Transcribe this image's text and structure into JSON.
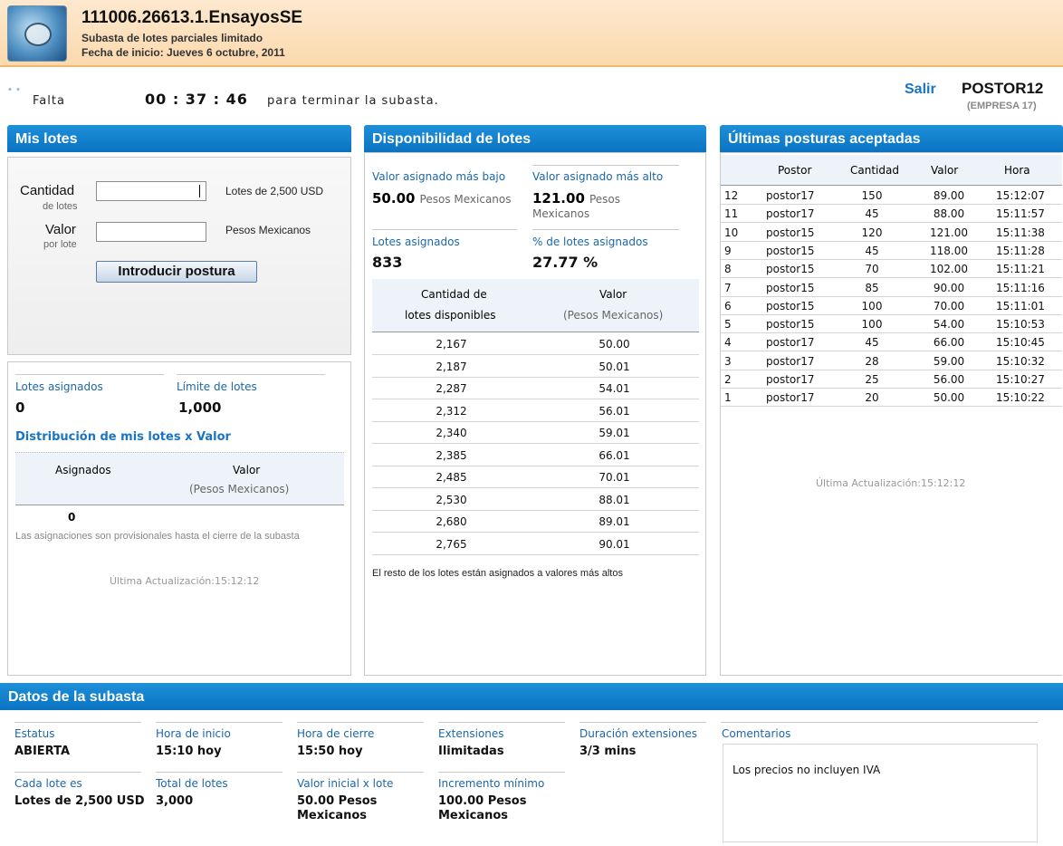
{
  "header": {
    "auction_code": "111006.26613.1.EnsayosSE",
    "auction_type": "Subasta de lotes parciales limitado",
    "start_date": "Fecha de inicio: Jueves 6 octubre, 2011"
  },
  "timer": {
    "prefix": "Falta",
    "value": "00 : 37 : 46",
    "suffix": "para terminar la subasta."
  },
  "user": {
    "logout_label": "Salir",
    "bidder": "POSTOR12",
    "company": "(EMPRESA 17)"
  },
  "mis_lotes": {
    "title": "Mis lotes",
    "quantity_label": "Cantidad",
    "quantity_sub": "de lotes",
    "quantity_value": "",
    "quantity_unit": "Lotes de 2,500 USD",
    "value_label": "Valor",
    "value_sub": "por lote",
    "value_value": "",
    "value_unit": "Pesos Mexicanos",
    "submit_label": "Introducir postura",
    "assigned_label": "Lotes asignados",
    "assigned_value": "0",
    "limit_label": "Límite de lotes",
    "limit_value": "1,000",
    "distribution_title": "Distribución de mis lotes x Valor",
    "col_assigned": "Asignados",
    "col_value": "Valor",
    "col_value_sub": "(Pesos Mexicanos)",
    "row_assigned": "0",
    "note": "Las asignaciones son provisionales hasta el cierre de la subasta",
    "updated": "Última Actualización:15:12:12"
  },
  "disponibilidad": {
    "title": "Disponibilidad de lotes",
    "lowest_label": "Valor asignado más bajo",
    "lowest_value": "50.00",
    "lowest_unit": "Pesos Mexicanos",
    "highest_label": "Valor asignado más alto",
    "highest_value": "121.00",
    "highest_unit_1": "Pesos",
    "highest_unit_2": "Mexicanos",
    "assigned_label": "Lotes asignados",
    "assigned_value": "833",
    "pct_label": "% de lotes asignados",
    "pct_value": "27.77 %",
    "col_qty_1": "Cantidad de",
    "col_qty_2": "lotes disponibles",
    "col_val_1": "Valor",
    "col_val_2": "(Pesos Mexicanos)",
    "rows": [
      {
        "qty": "2,167",
        "val": "50.00"
      },
      {
        "qty": "2,187",
        "val": "50.01"
      },
      {
        "qty": "2,287",
        "val": "54.01"
      },
      {
        "qty": "2,312",
        "val": "56.01"
      },
      {
        "qty": "2,340",
        "val": "59.01"
      },
      {
        "qty": "2,385",
        "val": "66.01"
      },
      {
        "qty": "2,485",
        "val": "70.01"
      },
      {
        "qty": "2,530",
        "val": "88.01"
      },
      {
        "qty": "2,680",
        "val": "89.01"
      },
      {
        "qty": "2,765",
        "val": "90.01"
      }
    ],
    "footer": "El resto de los lotes están asignados a valores más altos"
  },
  "posturas": {
    "title": "Últimas posturas aceptadas",
    "columns": [
      "Postor",
      "Cantidad",
      "Valor",
      "Hora"
    ],
    "rows": [
      {
        "n": "12",
        "postor": "postor17",
        "qty": "150",
        "val": "89.00",
        "hora": "15:12:07"
      },
      {
        "n": "11",
        "postor": "postor17",
        "qty": "45",
        "val": "88.00",
        "hora": "15:11:57"
      },
      {
        "n": "10",
        "postor": "postor15",
        "qty": "120",
        "val": "121.00",
        "hora": "15:11:38"
      },
      {
        "n": "9",
        "postor": "postor15",
        "qty": "45",
        "val": "118.00",
        "hora": "15:11:28"
      },
      {
        "n": "8",
        "postor": "postor15",
        "qty": "70",
        "val": "102.00",
        "hora": "15:11:21"
      },
      {
        "n": "7",
        "postor": "postor15",
        "qty": "85",
        "val": "90.00",
        "hora": "15:11:16"
      },
      {
        "n": "6",
        "postor": "postor15",
        "qty": "100",
        "val": "70.00",
        "hora": "15:11:01"
      },
      {
        "n": "5",
        "postor": "postor15",
        "qty": "100",
        "val": "54.00",
        "hora": "15:10:53"
      },
      {
        "n": "4",
        "postor": "postor17",
        "qty": "45",
        "val": "66.00",
        "hora": "15:10:45"
      },
      {
        "n": "3",
        "postor": "postor17",
        "qty": "28",
        "val": "59.00",
        "hora": "15:10:32"
      },
      {
        "n": "2",
        "postor": "postor17",
        "qty": "25",
        "val": "56.00",
        "hora": "15:10:27"
      },
      {
        "n": "1",
        "postor": "postor17",
        "qty": "20",
        "val": "50.00",
        "hora": "15:10:22"
      }
    ],
    "updated": "Última Actualización:15:12:12"
  },
  "datos": {
    "title": "Datos de la subasta",
    "estatus_label": "Estatus",
    "estatus_value": "ABIERTA",
    "inicio_label": "Hora de inicio",
    "inicio_value": "15:10 hoy",
    "cierre_label": "Hora de cierre",
    "cierre_value": "15:50 hoy",
    "ext_label": "Extensiones",
    "ext_value": "Ilimitadas",
    "dur_label": "Duración extensiones",
    "dur_value": "3/3 mins",
    "lote_label": "Cada lote es",
    "lote_value": "Lotes de 2,500 USD",
    "total_label": "Total de lotes",
    "total_value": "3,000",
    "vinicial_label": "Valor inicial x lote",
    "vinicial_value_1": "50.00 Pesos",
    "vinicial_value_2": "Mexicanos",
    "inc_label": "Incremento mínimo",
    "inc_value_1": "100.00 Pesos",
    "inc_value_2": "Mexicanos",
    "comentarios_label": "Comentarios",
    "comentarios_value": "Los precios no incluyen IVA"
  }
}
